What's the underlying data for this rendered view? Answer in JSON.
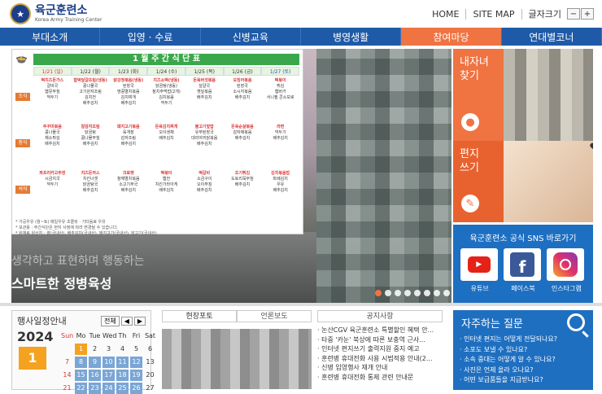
{
  "header": {
    "logo_text": "육군훈련소",
    "logo_sub": "Korea Army Training Center",
    "util_links": [
      "HOME",
      "SITE MAP"
    ],
    "font_size_label": "글자크기",
    "font_minus": "−",
    "font_plus": "+"
  },
  "nav": {
    "items": [
      "부대소개",
      "입영 · 수료",
      "신병교육",
      "병영생활",
      "참여마당",
      "연대별코너"
    ],
    "active_index": 4
  },
  "colors": {
    "nav_blue": "#1e5aa8",
    "accent_orange": "#f07342",
    "sns_blue": "#1d6fc2"
  },
  "hero": {
    "menu_title": "1 월  주 간 식 단 표",
    "days": [
      "1/21 (일)",
      "1/22 (월)",
      "1/23 (화)",
      "1/24 (수)",
      "1/25 (목)",
      "1/26 (금)",
      "1/27 (토)"
    ],
    "meal_labels": [
      "조식",
      "중식",
      "석식"
    ],
    "rows": [
      [
        [
          "떡치즈돈가스",
          "갈비국",
          "햄뭇무침",
          "깍두기"
        ],
        [
          "함박달걀조림(냉동)",
          "콩나물국",
          "고기완자조림",
          "김치전",
          "배추김치"
        ],
        [
          "닭강정볶음(냉동)",
          "된장국",
          "땅콩멸치볶음",
          "김치찌개",
          "배추김치"
        ],
        [
          "치즈소떡(냉동)",
          "닭곰탕(냉동)",
          "참치주먹밥(2개)",
          "김치볶음",
          "깍두기"
        ],
        [
          "돈육버섯볶음",
          "달걀국",
          "깻잎볶음",
          "배추김치"
        ],
        [
          "오징어볶음",
          "된장국",
          "소시지볶음",
          "배추김치"
        ],
        [
          "떡볶이",
          "튀김",
          "햄버거",
          "서니필 콘소보로"
        ]
      ],
      [
        [
          "주꾸미볶음",
          "콩나물국",
          "채소튀김",
          "배추김치"
        ],
        [
          "알감자조림",
          "닭곰탕",
          "콩나물무침",
          "배추김치"
        ],
        [
          "돼지고기볶음",
          "육개장",
          "감자조림",
          "배추김치"
        ],
        [
          "돈육김치찌개",
          "오이생채",
          "배추김치"
        ],
        [
          "불고기덮밥",
          "유부된장국",
          "데리야끼닭볶음",
          "배추김치"
        ],
        [
          "돈육순살볶음",
          "감자채볶음",
          "배추김치"
        ],
        [
          "라면",
          "깍두기",
          "배추김치"
        ]
      ],
      [
        [
          "파프리카고추장",
          "시금치국",
          "깍두기"
        ],
        [
          "치즈돈까스",
          "치킨너겟",
          "닭곰탕국",
          "배추김치"
        ],
        [
          "크로켓",
          "참깨멸치볶음",
          "소고기무국",
          "배추김치"
        ],
        [
          "떡볶이",
          "햄전",
          "치킨가라아게",
          "배추김치"
        ],
        [
          "떡갈비",
          "소금구이",
          "오이무침",
          "배추김치"
        ],
        [
          "조기튀김",
          "도토리묵무침",
          "배추김치"
        ],
        [
          "김치볶음밥",
          "파쇄김치",
          "우유",
          "배추김치"
        ]
      ]
    ],
    "foot_lines": [
      "* 가공우유 (월~토)  매일우유 초콜릿  ·  기타음료 우유",
      "* 보관용 : 주간식단은 현지 사정에 따라 변경될 수 있습니다.",
      "* 원재료 원산지 : 쌀(국내산), 배추김치(국내산), 돼지고기(국내산), 닭고기(국내산)"
    ],
    "caption_line1": "생각하고 표현하며 행동하는",
    "caption_line2": "스마트한 정병육성",
    "slide_count": 8,
    "active_slide": 0
  },
  "side": {
    "visit": {
      "line1": "내자녀",
      "line2": "찾기"
    },
    "letter": {
      "line1": "편지",
      "line2": "쓰기"
    },
    "sns": {
      "title": "육군훈련소 공식 SNS 바로가기",
      "items": [
        "유튜브",
        "페이스북",
        "인스타그램"
      ]
    }
  },
  "calendar": {
    "title": "행사일정안내",
    "all_label": "전체",
    "prev": "◀",
    "next": "▶",
    "year": "2024",
    "month": "1",
    "weekdays": [
      "Sun",
      "Mo",
      "Tue",
      "Wed",
      "Th",
      "Fri",
      "Sat"
    ],
    "cells": [
      "",
      "1",
      "2",
      "3",
      "4",
      "5",
      "6",
      "7",
      "8",
      "9",
      "10",
      "11",
      "12",
      "13",
      "14",
      "15",
      "16",
      "17",
      "18",
      "19",
      "20",
      "21",
      "22",
      "23",
      "24",
      "25",
      "26",
      "27"
    ]
  },
  "news": {
    "tabs": [
      "현장포토",
      "언론보도"
    ]
  },
  "notice": {
    "tab": "공지사항",
    "items": [
      "· 논산CGV 육군훈련소 특별할인 혜택 안...",
      "· 타중 '카눈' 북상에 따른 보충역 근사...",
      "· 인터넷 편지쓰기 출력지원 중지 예고",
      "· 훈련병 휴대전화 사용 시범적용 안내(2...",
      "· 신병 입영행사 재개 안내",
      "· 훈련병 휴대전화 통제 관련 안내문"
    ]
  },
  "faq": {
    "title": "자주하는 질문",
    "items": [
      "· 인터넷 편지는 어떻게 전달되나요?",
      "· 소포도 보낼 수 있나요?",
      "· 소속 중대는 어떻게 알 수 있나요?",
      "· 사진은 언제 올라 오나요?",
      "· 어떤 보급품들을 지급받나요?"
    ]
  }
}
